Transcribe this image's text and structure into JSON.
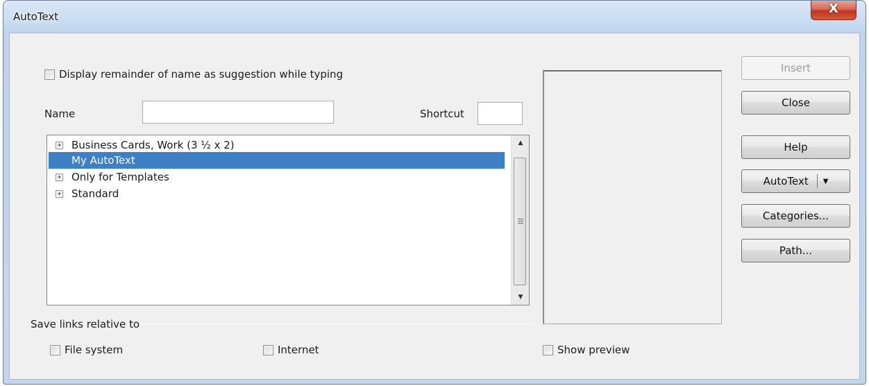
{
  "window": {
    "title": "AutoText",
    "close_glyph": "X"
  },
  "options": {
    "display_remainder_label": "Display remainder of name as suggestion while typing"
  },
  "fields": {
    "name_label": "Name",
    "name_value": "",
    "shortcut_label": "Shortcut",
    "shortcut_value": ""
  },
  "categories_list": {
    "items": [
      {
        "label": "Business Cards, Work (3 ½ x 2)",
        "expandable": true,
        "selected": false
      },
      {
        "label": "My AutoText",
        "expandable": false,
        "selected": true
      },
      {
        "label": "Only for Templates",
        "expandable": true,
        "selected": false
      },
      {
        "label": "Standard",
        "expandable": true,
        "selected": false
      }
    ],
    "expand_glyph": "+"
  },
  "save_links": {
    "group_label": "Save links relative to",
    "file_system_label": "File system",
    "internet_label": "Internet"
  },
  "preview": {
    "show_preview_label": "Show preview"
  },
  "buttons": {
    "insert": "Insert",
    "close": "Close",
    "help": "Help",
    "autotext": "AutoText",
    "categories": "Categories...",
    "path": "Path..."
  }
}
